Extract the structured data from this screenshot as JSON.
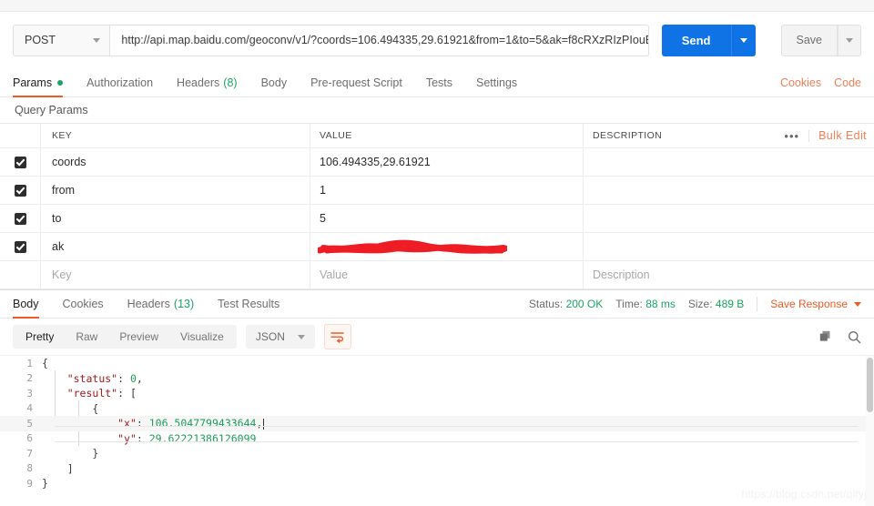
{
  "request": {
    "method": "POST",
    "url": "http://api.map.baidu.com/geoconv/v1/?coords=106.494335,29.61921&from=1&to=5&ak=f8cRXzRIzPIouB ...",
    "send_label": "Send",
    "save_label": "Save"
  },
  "request_tabs": [
    {
      "label": "Params",
      "badge": "dot",
      "active": true
    },
    {
      "label": "Authorization",
      "badge": "",
      "active": false
    },
    {
      "label": "Headers",
      "badge": "(8)",
      "active": false
    },
    {
      "label": "Body",
      "badge": "",
      "active": false
    },
    {
      "label": "Pre-request Script",
      "badge": "",
      "active": false
    },
    {
      "label": "Tests",
      "badge": "",
      "active": false
    },
    {
      "label": "Settings",
      "badge": "",
      "active": false
    }
  ],
  "request_tabs_right": {
    "cookies": "Cookies",
    "code": "Code"
  },
  "query_params": {
    "title": "Query Params",
    "columns": {
      "key": "KEY",
      "value": "VALUE",
      "description": "DESCRIPTION"
    },
    "bulk_edit": "Bulk Edit",
    "more": "•••",
    "rows": [
      {
        "checked": true,
        "key": "coords",
        "value": "106.494335,29.61921",
        "description": "",
        "redacted": false
      },
      {
        "checked": true,
        "key": "from",
        "value": "1",
        "description": "",
        "redacted": false
      },
      {
        "checked": true,
        "key": "to",
        "value": "5",
        "description": "",
        "redacted": false
      },
      {
        "checked": true,
        "key": "ak",
        "value": "",
        "description": "",
        "redacted": true
      }
    ],
    "placeholder_row": {
      "key": "Key",
      "value": "Value",
      "description": "Description"
    }
  },
  "response_tabs": [
    {
      "label": "Body",
      "badge": "",
      "active": true
    },
    {
      "label": "Cookies",
      "badge": "",
      "active": false
    },
    {
      "label": "Headers",
      "badge": "(13)",
      "active": false
    },
    {
      "label": "Test Results",
      "badge": "",
      "active": false
    }
  ],
  "response_meta": {
    "status_label": "Status:",
    "status_value": "200 OK",
    "time_label": "Time:",
    "time_value": "88 ms",
    "size_label": "Size:",
    "size_value": "489 B",
    "save_response": "Save Response"
  },
  "response_toolbar": {
    "views": [
      {
        "label": "Pretty",
        "active": true
      },
      {
        "label": "Raw",
        "active": false
      },
      {
        "label": "Preview",
        "active": false
      },
      {
        "label": "Visualize",
        "active": false
      }
    ],
    "format": "JSON"
  },
  "response_body": {
    "lines": [
      {
        "n": "1",
        "indent": 0,
        "parts": [
          {
            "t": "{",
            "c": "p"
          }
        ],
        "highlight": false
      },
      {
        "n": "2",
        "indent": 1,
        "parts": [
          {
            "t": "\"status\"",
            "c": "k"
          },
          {
            "t": ": ",
            "c": "p"
          },
          {
            "t": "0",
            "c": "v"
          },
          {
            "t": ",",
            "c": "p"
          }
        ],
        "highlight": false
      },
      {
        "n": "3",
        "indent": 1,
        "parts": [
          {
            "t": "\"result\"",
            "c": "k"
          },
          {
            "t": ": [",
            "c": "p"
          }
        ],
        "highlight": false
      },
      {
        "n": "4",
        "indent": 2,
        "parts": [
          {
            "t": "{",
            "c": "p"
          }
        ],
        "highlight": false
      },
      {
        "n": "5",
        "indent": 3,
        "parts": [
          {
            "t": "\"x\"",
            "c": "k"
          },
          {
            "t": ": ",
            "c": "p"
          },
          {
            "t": "106.5047799433644",
            "c": "v"
          },
          {
            "t": ",",
            "c": "p"
          }
        ],
        "highlight": true
      },
      {
        "n": "6",
        "indent": 3,
        "parts": [
          {
            "t": "\"y\"",
            "c": "k"
          },
          {
            "t": ": ",
            "c": "p"
          },
          {
            "t": "29.62221386126099",
            "c": "v"
          }
        ],
        "highlight": false
      },
      {
        "n": "7",
        "indent": 2,
        "parts": [
          {
            "t": "}",
            "c": "p"
          }
        ],
        "highlight": false
      },
      {
        "n": "8",
        "indent": 1,
        "parts": [
          {
            "t": "]",
            "c": "p"
          }
        ],
        "highlight": false
      },
      {
        "n": "9",
        "indent": 0,
        "parts": [
          {
            "t": "}",
            "c": "p"
          }
        ],
        "highlight": false
      }
    ]
  },
  "watermark": "https://blog.csdn.net/qlfyj",
  "colors": {
    "accent_orange": "#ef5b25",
    "send_blue": "#0f72e5",
    "status_green": "#19a463",
    "redaction_red": "#ee1c24"
  }
}
